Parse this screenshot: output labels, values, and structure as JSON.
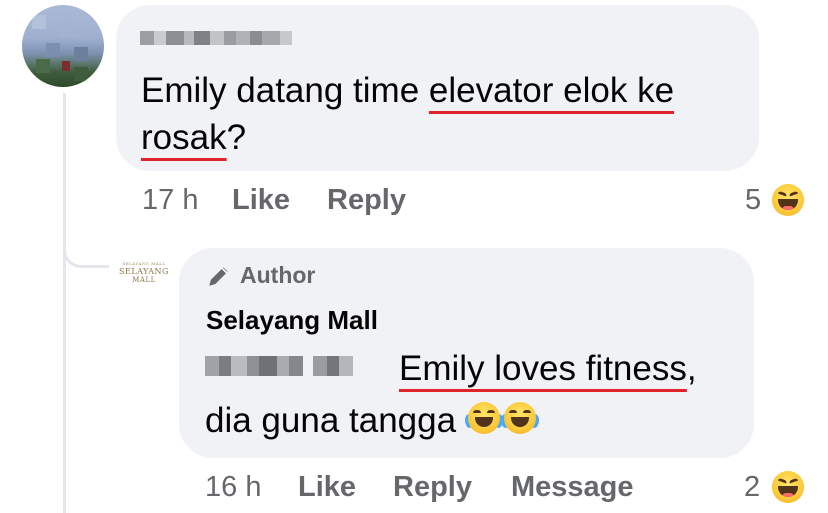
{
  "comment": {
    "author_blurred": true,
    "text_before": "Emily datang time ",
    "text_underlined_1": "elevator elok ke",
    "text_underlined_2": "rosak",
    "text_after": "?",
    "time": "17 h",
    "like_label": "Like",
    "reply_label": "Reply",
    "reaction_count": "5",
    "reaction_icon": "laughing-emoji"
  },
  "reply": {
    "badge_icon": "pen-icon",
    "badge_label": "Author",
    "author_name": "Selayang Mall",
    "mention_blurred": true,
    "text_underlined": "Emily loves fitness",
    "text_after_underline": ",",
    "text_line2": "dia guna tangga ",
    "emoji": "tears-of-joy-emoji x2",
    "avatar_logo_lines": [
      "SELAYANG MALL",
      "SELAYANG",
      "MALL"
    ],
    "time": "16 h",
    "like_label": "Like",
    "reply_label": "Reply",
    "message_label": "Message",
    "reaction_count": "2",
    "reaction_icon": "laughing-emoji"
  },
  "colors": {
    "bubble": "#f0f2f5",
    "meta_text": "#65676b",
    "underline": "#e0242a",
    "thread_line": "#e4e6eb"
  }
}
